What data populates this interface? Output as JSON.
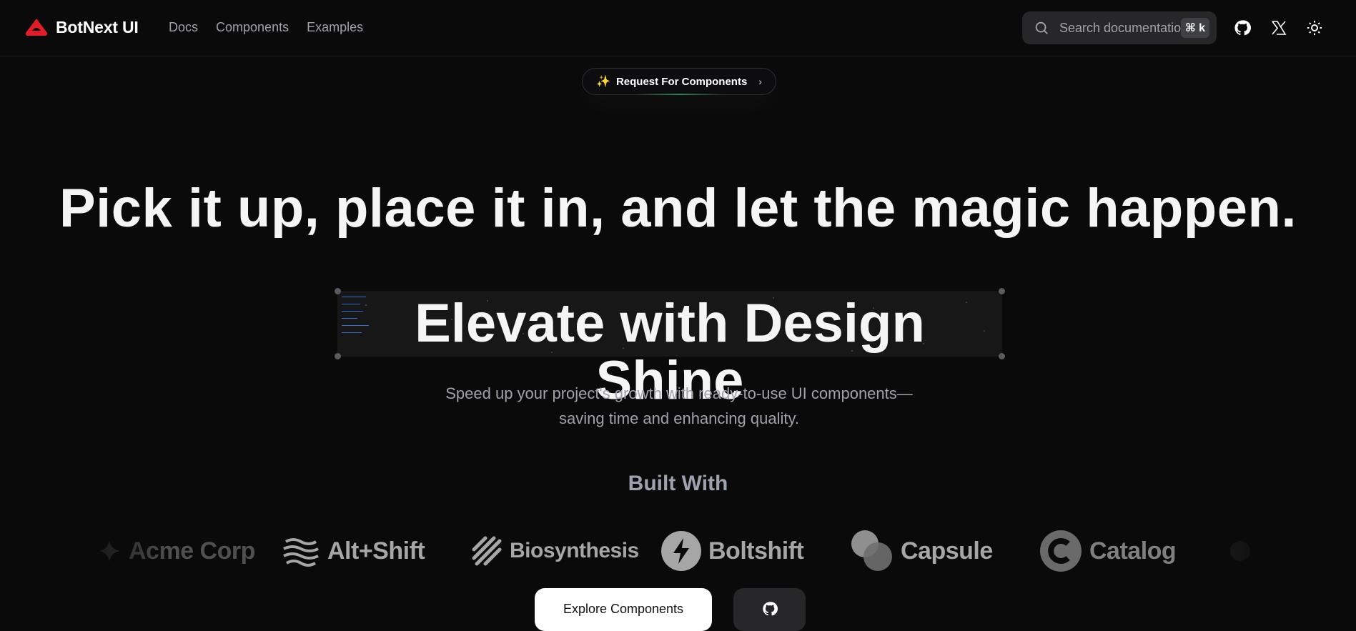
{
  "brand": {
    "name": "BotNext UI",
    "logo_icon": "red-cap-logo"
  },
  "nav": {
    "links": [
      "Docs",
      "Components",
      "Examples"
    ]
  },
  "search": {
    "placeholder": "Search documentation",
    "shortcut": "⌘ k"
  },
  "header_icons": [
    "github-icon",
    "x-twitter-icon",
    "sun-icon"
  ],
  "announcement": {
    "emoji": "✨",
    "label": "Request For Components",
    "chevron": "›"
  },
  "hero": {
    "title": "Pick it up, place it in, and let the magic happen.",
    "shine_text": "Elevate with Design Shine",
    "subtitle": "Speed up your project's growth with ready-to-use UI components—saving time and enhancing quality."
  },
  "built_with": {
    "heading": "Built With",
    "logos": [
      "Acme Corp",
      "Alt+Shift",
      "Biosynthesis",
      "Boltshift",
      "Capsule",
      "Catalog"
    ]
  },
  "cta": {
    "explore_label": "Explore Components",
    "github_icon": "github-icon"
  },
  "colors": {
    "background": "#0a0a0b",
    "brand_red": "#e11d28",
    "accent_text": "#f5f5f5",
    "muted": "#a1a1aa"
  }
}
